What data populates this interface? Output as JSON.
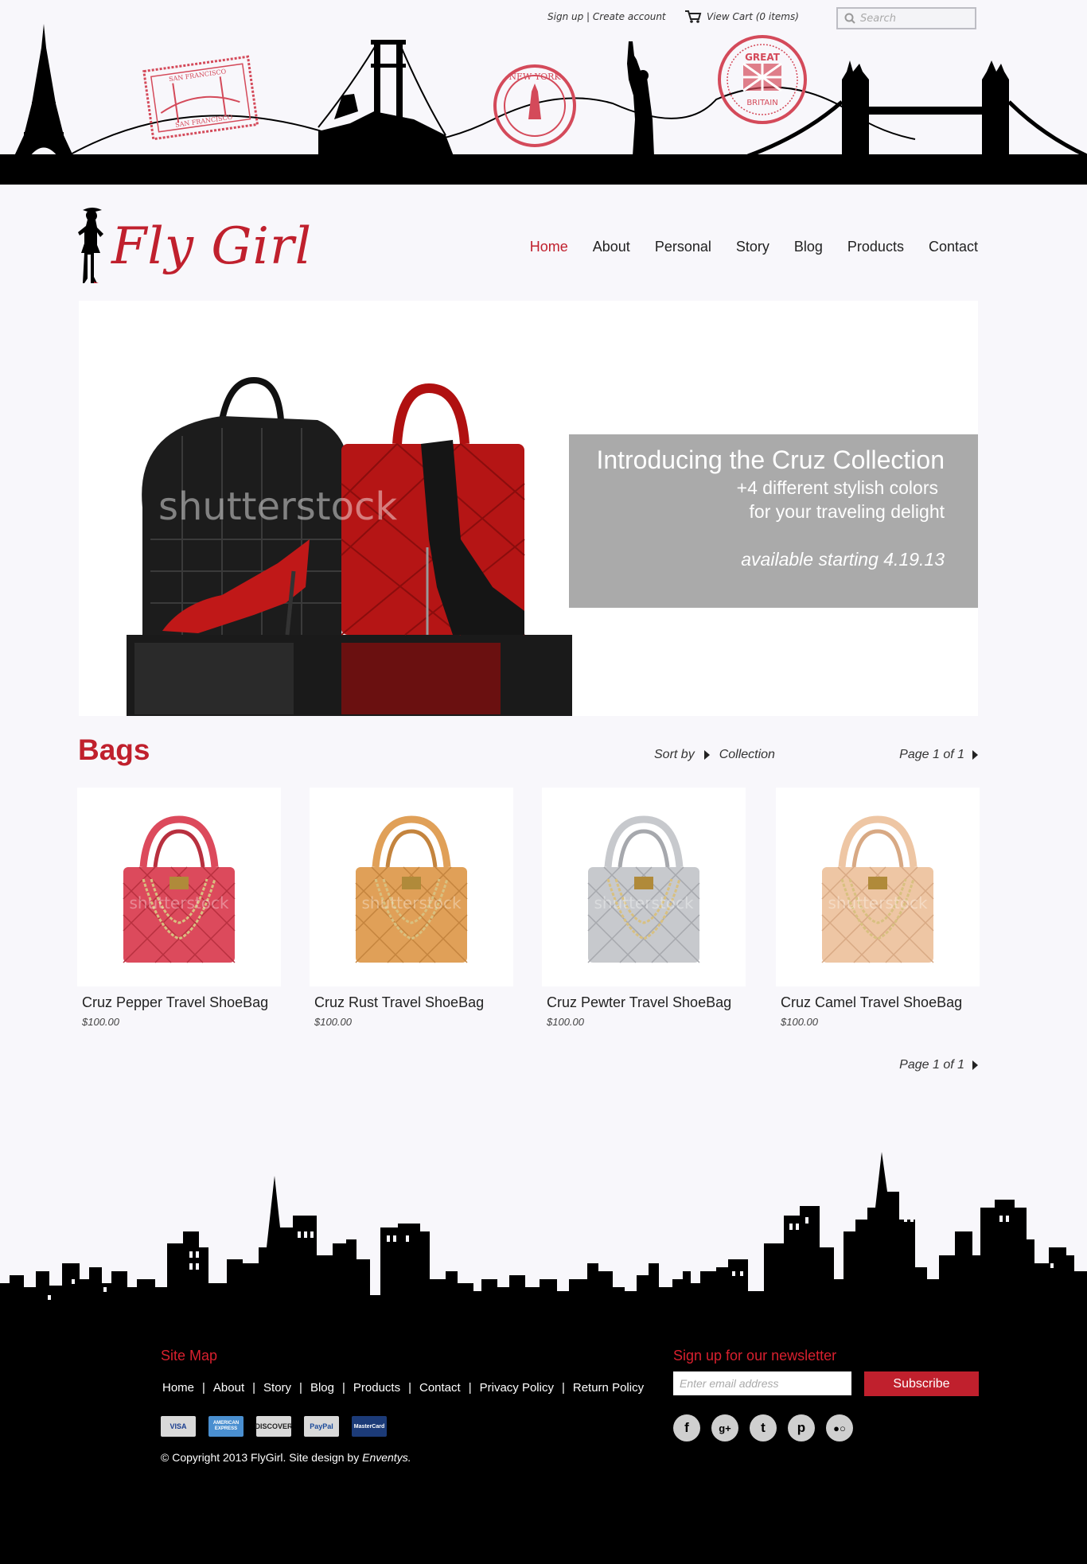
{
  "utility": {
    "signup_text": "Sign up | Create account",
    "cart_text": "View Cart (0 items)",
    "search_placeholder": "Search"
  },
  "logo": {
    "text": "Fly Girl"
  },
  "nav": {
    "items": [
      {
        "label": "Home",
        "active": true
      },
      {
        "label": "About",
        "active": false
      },
      {
        "label": "Personal",
        "active": false
      },
      {
        "label": "Story",
        "active": false
      },
      {
        "label": "Blog",
        "active": false
      },
      {
        "label": "Products",
        "active": false
      },
      {
        "label": "Contact",
        "active": false
      }
    ]
  },
  "stamps": {
    "san_francisco": "SAN FRANCISCO",
    "new_york": "NEW YORK",
    "great_britain": "GREAT BRITAIN"
  },
  "hero": {
    "intro": "Introducing the",
    "collection": "Cruz Collection",
    "line2": "+4 different stylish colors",
    "line3": "for your traveling delight",
    "line4": "available starting 4.19.13",
    "watermark": "shutterstock"
  },
  "section": {
    "title": "Bags",
    "sort_label": "Sort by",
    "sort_value": "Collection",
    "pager_text": "Page 1 of 1"
  },
  "products": [
    {
      "name": "Cruz Pepper Travel ShoeBag",
      "price": "$100.00",
      "color": "#dc4a5c",
      "dark": "#b8303f",
      "watermark": "shutterstock"
    },
    {
      "name": "Cruz Rust Travel ShoeBag",
      "price": "$100.00",
      "color": "#e0a058",
      "dark": "#c4843e",
      "watermark": "shutterstock"
    },
    {
      "name": "Cruz Pewter Travel ShoeBag",
      "price": "$100.00",
      "color": "#c7c9cd",
      "dark": "#a6a8ad",
      "watermark": "shutterstock"
    },
    {
      "name": "Cruz Camel Travel ShoeBag",
      "price": "$100.00",
      "color": "#eec6a4",
      "dark": "#d8a984",
      "watermark": "shutterstock"
    }
  ],
  "footer": {
    "sitemap_heading": "Site Map",
    "links": [
      "Home",
      "About",
      "Story",
      "Blog",
      "Products",
      "Contact",
      "Privacy Policy",
      "Return Policy"
    ],
    "cards": [
      {
        "label": "VISA",
        "bg": "#d9d9d9",
        "fg": "#1a3d8f"
      },
      {
        "label": "AMERICAN EXPRESS",
        "bg": "#4a8fd0",
        "fg": "#ffffff"
      },
      {
        "label": "DISCOVER",
        "bg": "#d9d9d9",
        "fg": "#222222"
      },
      {
        "label": "PayPal",
        "bg": "#d9d9d9",
        "fg": "#1a4a9a"
      },
      {
        "label": "MasterCard",
        "bg": "#1c3b78",
        "fg": "#ffffff"
      }
    ],
    "copyright": "Copyright 2013 FlyGirl. Site design by",
    "designer": "Enventys.",
    "newsletter_heading": "Sign up for our newsletter",
    "email_placeholder": "Enter email address",
    "subscribe_label": "Subscribe",
    "socials": [
      {
        "icon": "facebook-icon",
        "glyph": "f"
      },
      {
        "icon": "google-plus-icon",
        "glyph": "g+"
      },
      {
        "icon": "twitter-icon",
        "glyph": "t"
      },
      {
        "icon": "pinterest-icon",
        "glyph": "p"
      },
      {
        "icon": "flickr-icon",
        "glyph": "●○"
      }
    ]
  },
  "colors": {
    "accent": "#c0202d",
    "background": "#f8f7fb",
    "footer": "#000000"
  }
}
